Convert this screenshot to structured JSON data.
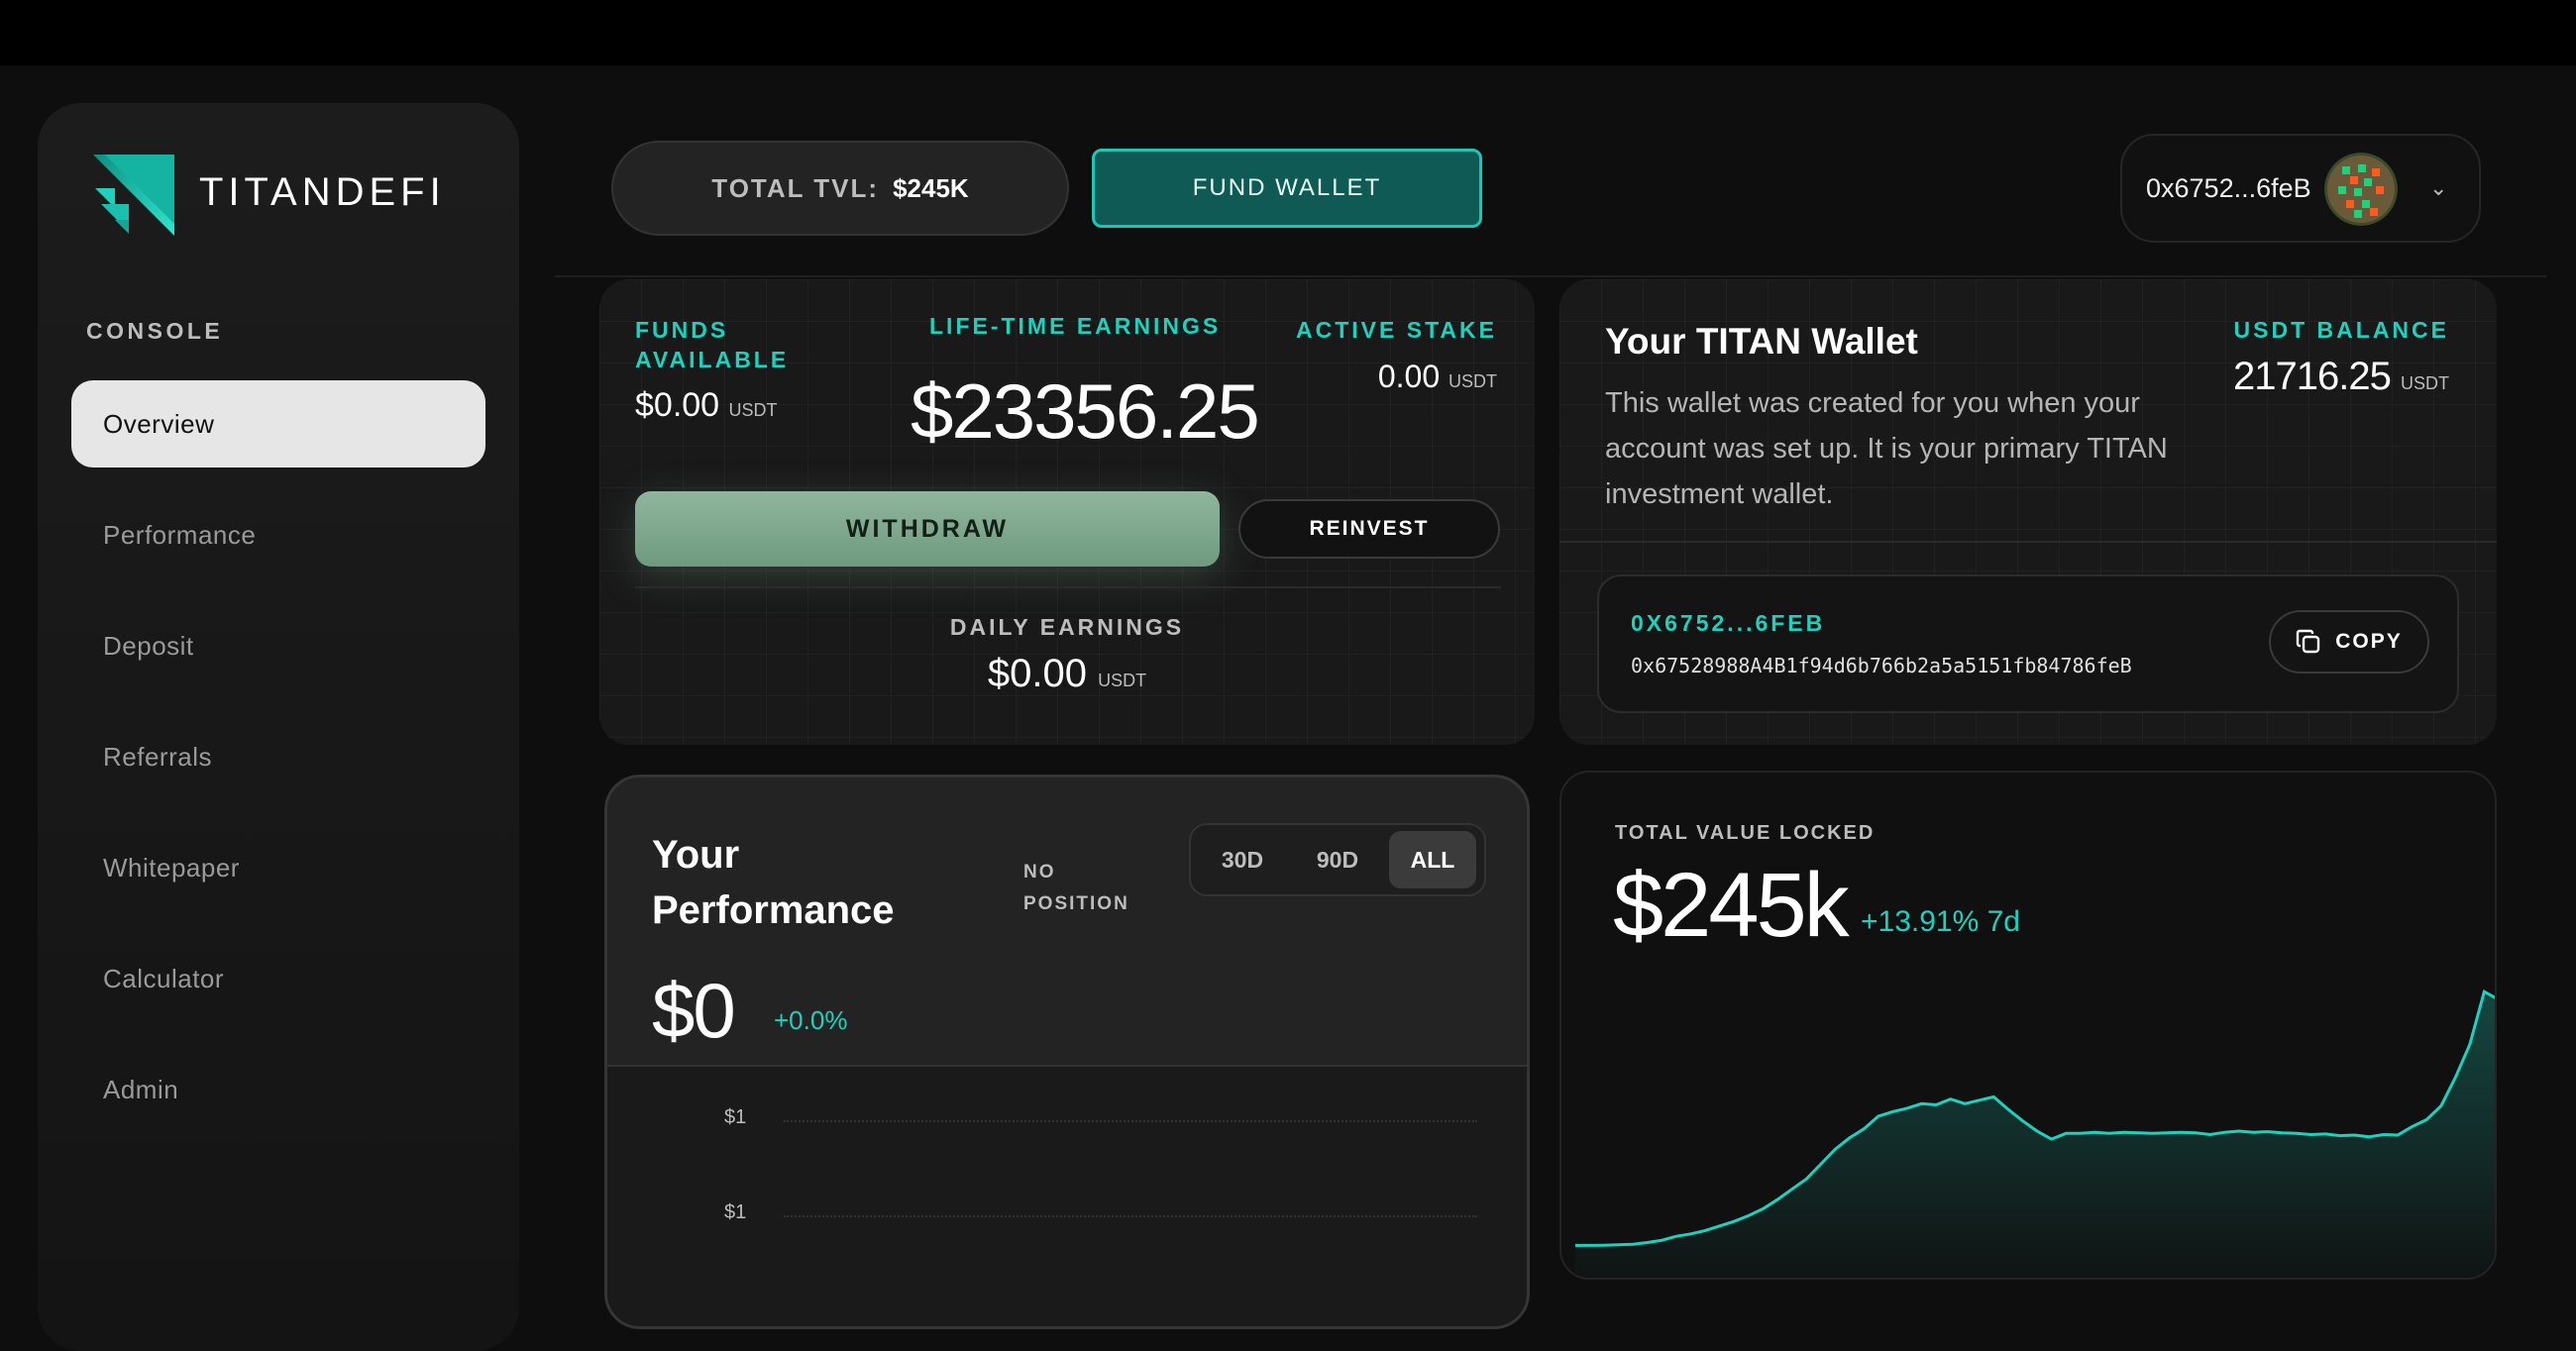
{
  "brand": {
    "name": "TITANDEFI"
  },
  "sidebar": {
    "section_label": "CONSOLE",
    "items": [
      {
        "label": "Overview",
        "active": true
      },
      {
        "label": "Performance"
      },
      {
        "label": "Deposit"
      },
      {
        "label": "Referrals"
      },
      {
        "label": "Whitepaper"
      },
      {
        "label": "Calculator"
      },
      {
        "label": "Admin"
      }
    ]
  },
  "header": {
    "tvl_label": "TOTAL TVL:",
    "tvl_value": "$245K",
    "fund_button": "FUND WALLET",
    "wallet_short": "0x6752...6feB",
    "chevron_icon": "chevron-down-icon"
  },
  "earnings": {
    "funds_label_line1": "FUNDS",
    "funds_label_line2": "AVAILABLE",
    "funds_value": "$0.00",
    "funds_unit": "USDT",
    "lifetime_label": "LIFE-TIME EARNINGS",
    "lifetime_value": "$23356.25",
    "active_label": "ACTIVE STAKE",
    "active_value": "0.00",
    "active_unit": "USDT",
    "withdraw_button": "WITHDRAW",
    "reinvest_button": "REINVEST",
    "daily_label": "DAILY EARNINGS",
    "daily_value": "$0.00",
    "daily_unit": "USDT"
  },
  "wallet": {
    "title": "Your TITAN Wallet",
    "description": "This wallet was created for you when your account was set up. It is your primary TITAN investment wallet.",
    "balance_label": "USDT BALANCE",
    "balance_value": "21716.25",
    "balance_unit": "USDT",
    "address_short": "0X6752...6FEB",
    "address_full": "0x67528988A4B1f94d6b766b2a5a5151fb84786feB",
    "copy_button": "COPY"
  },
  "performance": {
    "title_line1": "Your",
    "title_line2": "Performance",
    "status_line1": "NO",
    "status_line2": "POSITION",
    "ranges": [
      "30D",
      "90D",
      "ALL"
    ],
    "selected_range": "ALL",
    "value": "$0",
    "change": "+0.0%",
    "y_ticks": [
      "$1",
      "$1"
    ]
  },
  "tvl_card": {
    "label": "TOTAL VALUE LOCKED",
    "value": "$245k",
    "change": "+13.91% 7d"
  },
  "colors": {
    "accent": "#1fd1bd",
    "fund_button_bg": "#0f5a54",
    "withdraw_bg": "#7fa88d"
  },
  "chart_data": {
    "type": "area",
    "title": "",
    "xlabel": "",
    "ylabel": "",
    "grid": false,
    "series": [
      {
        "values": [
          30,
          30,
          30.2,
          30.5,
          31,
          32.5,
          34.5,
          38,
          40,
          43,
          47,
          51,
          56,
          62,
          70,
          79,
          88,
          101,
          114,
          124,
          132,
          143,
          147,
          150,
          154,
          153,
          158,
          154,
          157,
          160,
          149,
          139,
          130,
          123,
          128,
          128,
          129,
          128,
          129,
          128.5,
          128,
          128.5,
          129,
          128.5,
          127,
          129,
          130,
          129,
          129.5,
          128.5,
          128,
          127,
          127.5,
          126,
          126.5,
          125,
          127,
          126.5,
          134,
          140,
          152,
          177,
          206,
          252,
          245
        ]
      }
    ]
  }
}
